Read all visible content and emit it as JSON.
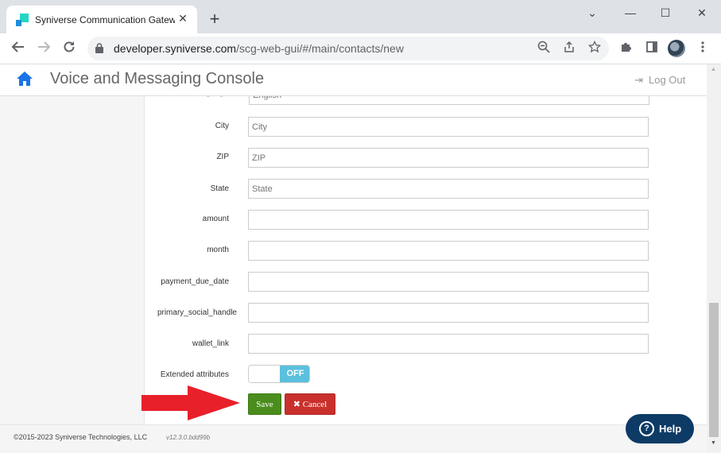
{
  "browser": {
    "tab_title": "Syniverse Communication Gatew",
    "tab_close": "✕",
    "new_tab": "+",
    "window_controls": {
      "minimize": "⌄",
      "restore": "—",
      "maximize": "☐",
      "close": "✕"
    },
    "url_host": "developer.syniverse.com",
    "url_path": "/scg-web-gui/#/main/contacts/new",
    "icons": [
      "back-icon",
      "forward-icon",
      "reload-icon",
      "lock-icon",
      "zoom-out-icon",
      "share-icon",
      "bookmark-star-icon",
      "extensions-icon",
      "side-panel-icon",
      "profile-avatar",
      "kebab-menu-icon"
    ]
  },
  "app": {
    "title": "Voice and Messaging Console",
    "logout_label": "Log Out",
    "brand_color": "#1a73e8"
  },
  "form": {
    "partial_label": "Preferred Language",
    "partial_value": "English",
    "fields": [
      {
        "label": "City",
        "placeholder": "City"
      },
      {
        "label": "ZIP",
        "placeholder": "ZIP"
      },
      {
        "label": "State",
        "placeholder": "State"
      },
      {
        "label": "amount",
        "placeholder": ""
      },
      {
        "label": "month",
        "placeholder": ""
      },
      {
        "label": "payment_due_date",
        "placeholder": ""
      },
      {
        "label": "primary_social_handle",
        "placeholder": ""
      },
      {
        "label": "wallet_link",
        "placeholder": ""
      }
    ],
    "extended_label": "Extended attributes",
    "toggle_state": "OFF",
    "save_label": "Save",
    "cancel_label": "Cancel",
    "save_color": "#4a8d1c",
    "cancel_color": "#c9302c",
    "annotation_arrow_color": "#e8202a"
  },
  "footer": {
    "copyright": "©2015-2023 Syniverse Technologies, LLC",
    "version": "v12.3.0.bdd99b"
  },
  "help": {
    "label": "Help"
  }
}
